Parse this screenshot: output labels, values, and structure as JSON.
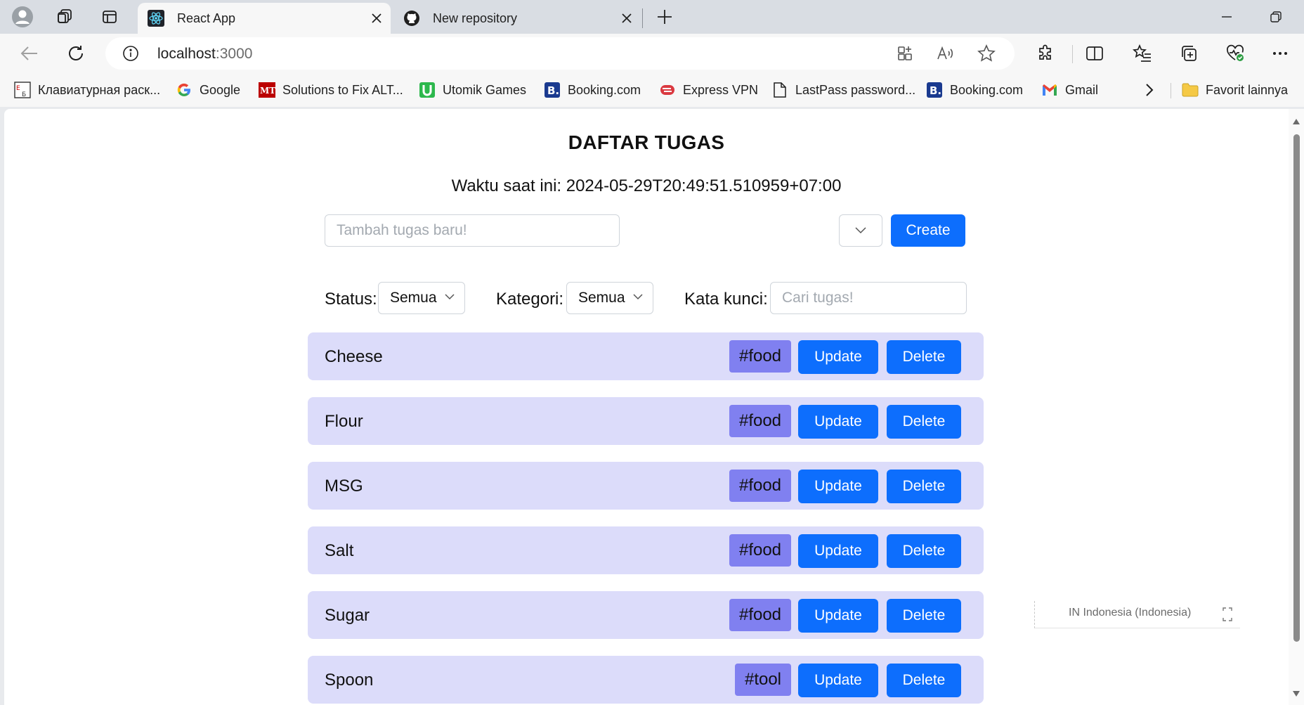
{
  "browser": {
    "tabs": [
      {
        "title": "React App",
        "favicon": "react-icon",
        "active": true
      },
      {
        "title": "New repository",
        "favicon": "github-icon",
        "active": false
      }
    ],
    "address": {
      "host": "localhost",
      "port": ":3000"
    },
    "bookmarks": [
      {
        "label": "Клавиатурная раск...",
        "icon": "keyboard-layout-icon"
      },
      {
        "label": "Google",
        "icon": "google-icon"
      },
      {
        "label": "Solutions to Fix ALT...",
        "icon": "mt-icon"
      },
      {
        "label": "Utomik Games",
        "icon": "utomik-icon"
      },
      {
        "label": "Booking.com",
        "icon": "booking-icon"
      },
      {
        "label": "Express VPN",
        "icon": "expressvpn-icon"
      },
      {
        "label": "LastPass password...",
        "icon": "page-icon"
      },
      {
        "label": "Booking.com",
        "icon": "booking-icon"
      },
      {
        "label": "Gmail",
        "icon": "gmail-icon"
      }
    ],
    "other_bookmarks": "Favorit lainnya"
  },
  "app": {
    "title": "DAFTAR TUGAS",
    "clock": "Waktu saat ini: 2024-05-29T20:49:51.510959+07:00",
    "new_task_placeholder": "Tambah tugas baru!",
    "create_label": "Create",
    "filters": {
      "status_label": "Status:",
      "status_value": "Semua",
      "category_label": "Kategori:",
      "category_value": "Semua",
      "keyword_label": "Kata kunci:",
      "keyword_placeholder": "Cari tugas!"
    },
    "tasks": [
      {
        "name": "Cheese",
        "tag": "#food",
        "update": "Update",
        "delete": "Delete"
      },
      {
        "name": "Flour",
        "tag": "#food",
        "update": "Update",
        "delete": "Delete"
      },
      {
        "name": "MSG",
        "tag": "#food",
        "update": "Update",
        "delete": "Delete"
      },
      {
        "name": "Salt",
        "tag": "#food",
        "update": "Update",
        "delete": "Delete"
      },
      {
        "name": "Sugar",
        "tag": "#food",
        "update": "Update",
        "delete": "Delete"
      },
      {
        "name": "Spoon",
        "tag": "#tool",
        "update": "Update",
        "delete": "Delete"
      }
    ]
  },
  "overlay": {
    "translate_hint": "IN  Indonesia (Indonesia)"
  },
  "colors": {
    "primary": "#0d6efd",
    "task_bg": "#dcdcfa",
    "tag_bg": "#8080f0"
  }
}
